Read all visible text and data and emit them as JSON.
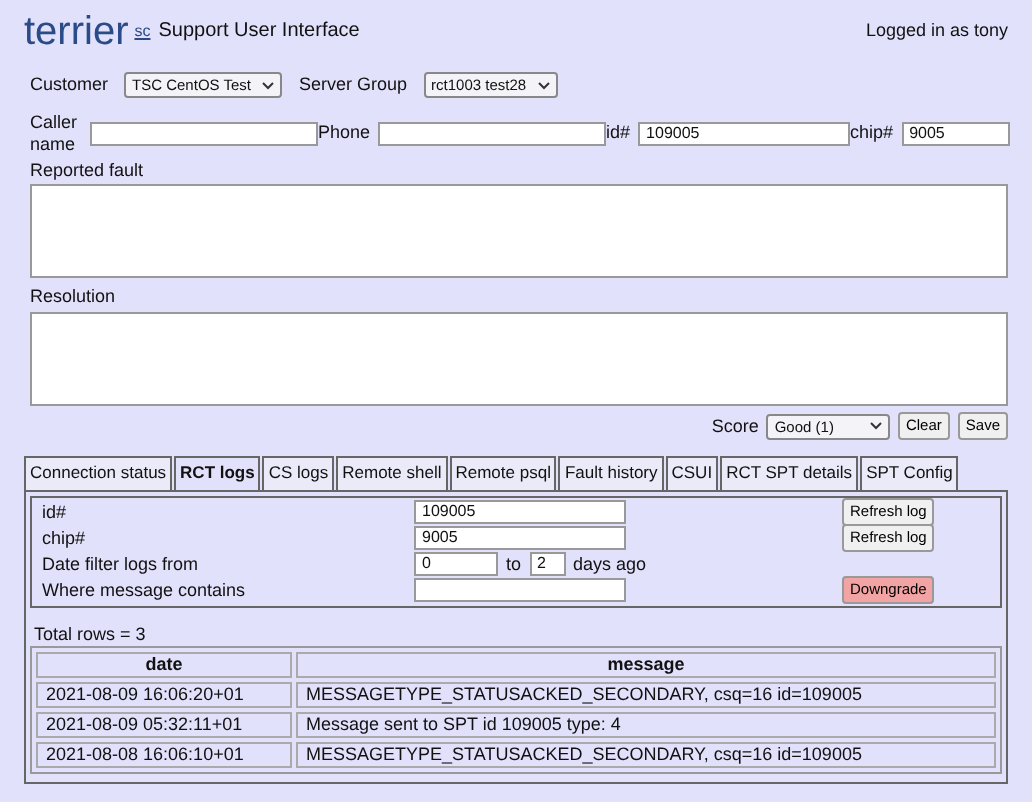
{
  "header": {
    "logo": "terrier",
    "logo_mark": "sc",
    "title": "Support User Interface",
    "user": "Logged in as tony"
  },
  "selectors": [
    {
      "label": "Customer",
      "value": "TSC CentOS Test"
    },
    {
      "label": "Server Group",
      "value": "rct1003 test28"
    }
  ],
  "caller": [
    {
      "label": "Caller name"
    },
    {
      "label": "Phone"
    },
    {
      "label": "id#",
      "value": "109005"
    },
    {
      "label": "chip#",
      "value": "9005"
    }
  ],
  "reported_fault": {
    "label": "Reported fault"
  },
  "resolution": {
    "label": "Resolution"
  },
  "score": {
    "label": "Score",
    "value": "Good (1)",
    "buttons": [
      "Clear",
      "Save"
    ]
  },
  "tabs": [
    {
      "label": "Connection status",
      "selected": false
    },
    {
      "label": "RCT logs",
      "selected": true
    },
    {
      "label": "CS logs",
      "selected": false
    },
    {
      "label": "Remote shell",
      "selected": false
    },
    {
      "label": "Remote psql",
      "selected": false
    },
    {
      "label": "Fault history",
      "selected": false
    },
    {
      "label": "CSUI",
      "selected": false
    },
    {
      "label": "RCT SPT details",
      "selected": false
    },
    {
      "label": "SPT Config",
      "selected": false
    }
  ],
  "filters": [
    {
      "kind": "text",
      "label": "id#",
      "value": "109005",
      "button": "Refresh log",
      "danger": false
    },
    {
      "kind": "text",
      "label": "chip#",
      "value": "9005",
      "button": "Refresh log",
      "danger": false
    },
    {
      "kind": "range",
      "label": "Date filter logs from",
      "from": "0",
      "to_label": "to",
      "to": "2",
      "suffix": "days ago"
    },
    {
      "kind": "text",
      "label": "Where message contains",
      "button": "Downgrade",
      "danger": true
    }
  ],
  "total_rows": "Total rows = 3",
  "table": {
    "columns": [
      "date",
      "message"
    ],
    "rows": [
      [
        "2021-08-09 16:06:20+01",
        "MESSAGETYPE_STATUSACKED_SECONDARY, csq=16 id=109005"
      ],
      [
        "2021-08-09 05:32:11+01",
        "Message sent to SPT id 109005 type: 4"
      ],
      [
        "2021-08-08 16:06:10+01",
        "MESSAGETYPE_STATUSACKED_SECONDARY, csq=16 id=109005"
      ]
    ]
  }
}
